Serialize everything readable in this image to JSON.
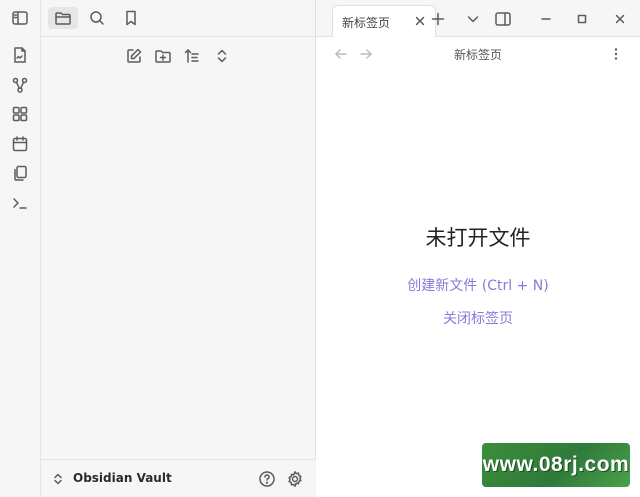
{
  "ribbon": {
    "items": [
      {
        "name": "open-quick-switcher-icon"
      },
      {
        "name": "graph-view-icon"
      },
      {
        "name": "canvas-icon"
      },
      {
        "name": "daily-note-icon"
      },
      {
        "name": "templates-icon"
      },
      {
        "name": "command-palette-icon"
      }
    ]
  },
  "sidebar": {
    "tabs": [
      "files",
      "search",
      "bookmarks"
    ],
    "active_tab": "files",
    "nav_actions": [
      "new-note",
      "new-folder",
      "sort",
      "collapse-all"
    ],
    "vault_name": "Obsidian Vault"
  },
  "tabs": [
    {
      "title": "新标签页",
      "active": true
    }
  ],
  "view": {
    "title": "新标签页",
    "empty_title": "未打开文件",
    "create_link": "创建新文件 (Ctrl + N)",
    "close_link": "关闭标签页"
  },
  "watermark": "www.08rj.com",
  "colors": {
    "accent": "#8a7ad6",
    "sidebar_bg": "#f6f6f6",
    "watermark_bg": "#3c8d3c"
  }
}
